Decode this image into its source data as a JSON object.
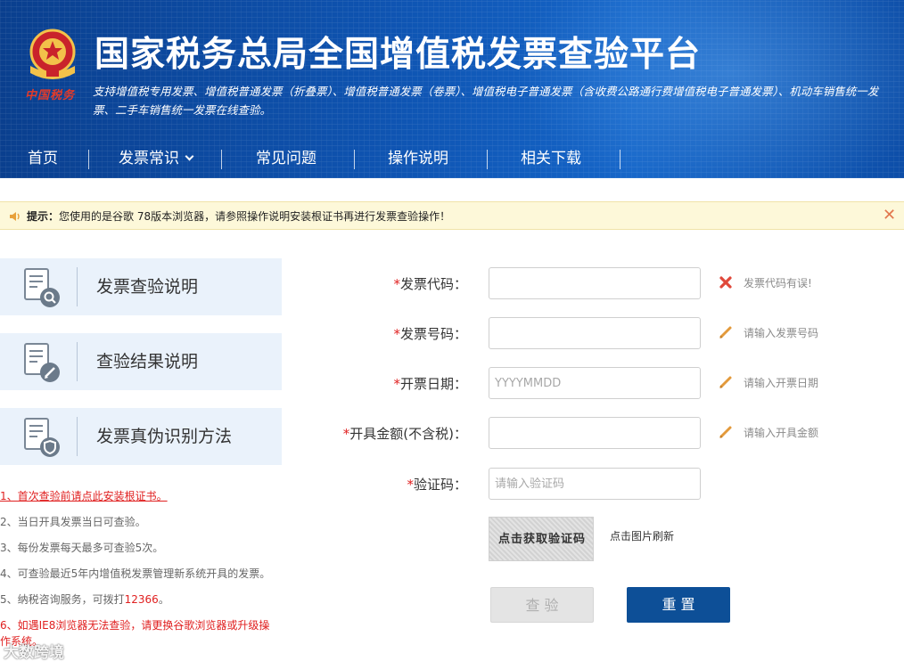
{
  "header": {
    "title": "国家税务总局全国增值税发票查验平台",
    "emblem_caption": "中国税务",
    "description": "支持增值税专用发票、增值税普通发票（折叠票）、增值税普通发票（卷票）、增值税电子普通发票（含收费公路通行费增值税电子普通发票）、机动车销售统一发票、二手车销售统一发票在线查验。"
  },
  "nav": {
    "items": [
      {
        "label": "首页"
      },
      {
        "label": "发票常识"
      },
      {
        "label": "常见问题"
      },
      {
        "label": "操作说明"
      },
      {
        "label": "相关下载"
      }
    ]
  },
  "notice": {
    "prefix": "提示：",
    "message": "您使用的是谷歌 78版本浏览器，请参照操作说明安装根证书再进行发票查验操作！",
    "close_glyph": "✕"
  },
  "sidebar": {
    "cards": [
      {
        "label": "发票查验说明",
        "icon": "document-search-icon"
      },
      {
        "label": "查验结果说明",
        "icon": "document-edit-icon"
      },
      {
        "label": "发票真伪识别方法",
        "icon": "document-shield-icon"
      }
    ]
  },
  "notes": {
    "n1": "1、首次查验前请点此安装根证书。",
    "n2": "2、当日开具发票当日可查验。",
    "n3": "3、每份发票每天最多可查验5次。",
    "n4": "4、可查验最近5年内增值税发票管理新系统开具的发票。",
    "n5_prefix": "5、纳税咨询服务，可拨打",
    "n5_phone": "12366",
    "n5_suffix": "。",
    "n6_line1": "6、如遇IE8浏览器无法查验，请更换谷歌浏览器或升级操",
    "n6_line2": "作系统。"
  },
  "form": {
    "required_mark": "*",
    "fields": [
      {
        "label": "发票代码：",
        "value": "",
        "placeholder": "",
        "hint": "发票代码有误!",
        "hint_icon": "error-x-icon"
      },
      {
        "label": "发票号码：",
        "value": "",
        "placeholder": "",
        "hint": "请输入发票号码",
        "hint_icon": "pencil-icon"
      },
      {
        "label": "开票日期：",
        "value": "",
        "placeholder": "YYYYMMDD",
        "hint": "请输入开票日期",
        "hint_icon": "pencil-icon"
      },
      {
        "label": "开具金额(不含税)：",
        "value": "",
        "placeholder": "",
        "hint": "请输入开具金额",
        "hint_icon": "pencil-icon"
      },
      {
        "label": "验证码：",
        "value": "",
        "placeholder": "请输入验证码"
      }
    ],
    "captcha_image_text": "点击获取验证码",
    "captcha_refresh": "点击图片刷新",
    "check_button": "查 验",
    "reset_button": "重 置"
  },
  "watermark": "大数跨境",
  "colors": {
    "header_blue": "#0f55b3",
    "error_red": "#e02020",
    "reset_button": "#0d4f97",
    "card_bg": "#eaf2fb",
    "notice_bg": "#fdf8d9"
  }
}
